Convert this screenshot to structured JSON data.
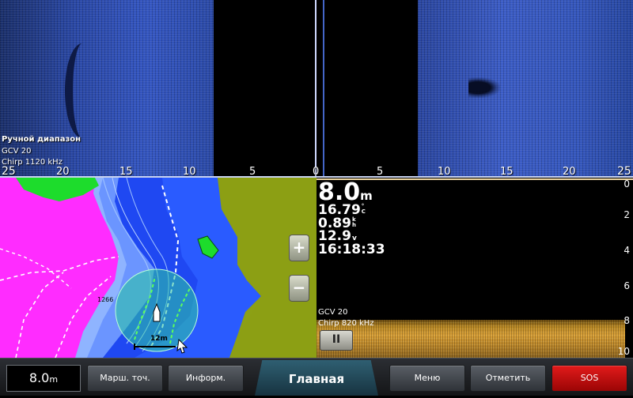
{
  "sidescan": {
    "mode_label": "Ручной диапазон",
    "transducer": "GCV 20",
    "frequency": "Chirp 1120 kHz",
    "left_scale": [
      "25",
      "20",
      "15",
      "10",
      "5",
      "0"
    ],
    "right_scale": [
      "5",
      "10",
      "15",
      "20",
      "25"
    ]
  },
  "map": {
    "zoom_in": "+",
    "zoom_out": "−",
    "scale_label": "12m",
    "contour_label": "1266",
    "colors": {
      "land": "#8c9f14",
      "shallow": "#ff2cff",
      "mid": "#7aa8ff",
      "deep": "#1f48f2",
      "water": "#2a62ff",
      "green": "#1ddc2c"
    }
  },
  "sonar": {
    "depth": "8.0",
    "depth_unit": "m",
    "temperature": "16.79",
    "temperature_unit": [
      "°",
      "C"
    ],
    "speed": "0.89",
    "speed_unit": [
      "k",
      "h"
    ],
    "voltage": "12.9",
    "voltage_unit": "v",
    "time": "16:18:33",
    "transducer": "GCV 20",
    "frequency": "Chirp 820 kHz",
    "depth_scale": [
      "0",
      "2",
      "4",
      "6",
      "8",
      "10"
    ],
    "pause_icon": "pause-icon",
    "pause_label": "II"
  },
  "toolbar": {
    "depth_value": "8.0",
    "depth_unit": "m",
    "waypoints": "Марш. точ.",
    "info": "Информ.",
    "home": "Главная",
    "menu": "Меню",
    "mark": "Отметить",
    "sos": "SOS",
    "colors": {
      "sos": "#d41010",
      "home_tab": "#25505f"
    }
  }
}
